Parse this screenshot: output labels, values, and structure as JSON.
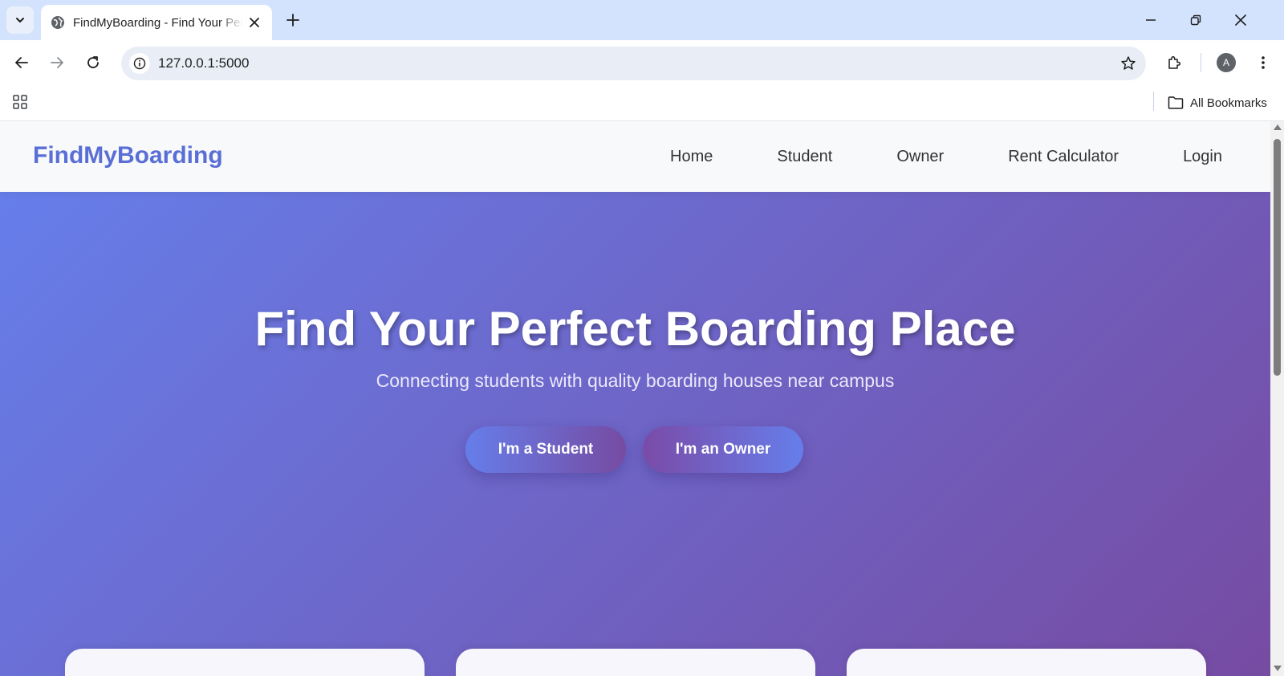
{
  "browser": {
    "tab": {
      "title": "FindMyBoarding - Find Your Perfect Boarding Place",
      "favicon_icon": "globe-icon"
    },
    "address_bar": {
      "url": "127.0.0.1:5000"
    },
    "profile_initial": "A",
    "bookmarks_bar": {
      "all_bookmarks_label": "All Bookmarks"
    }
  },
  "site": {
    "logo": "FindMyBoarding",
    "nav": [
      {
        "label": "Home"
      },
      {
        "label": "Student"
      },
      {
        "label": "Owner"
      },
      {
        "label": "Rent Calculator"
      },
      {
        "label": "Login"
      }
    ],
    "hero": {
      "title": "Find Your Perfect Boarding Place",
      "subtitle": "Connecting students with quality boarding houses near campus",
      "student_button": "I'm a Student",
      "owner_button": "I'm an Owner"
    }
  },
  "colors": {
    "brand": "#5a6fd6",
    "hero_gradient_start": "#667eea",
    "hero_gradient_end": "#764ba2"
  }
}
